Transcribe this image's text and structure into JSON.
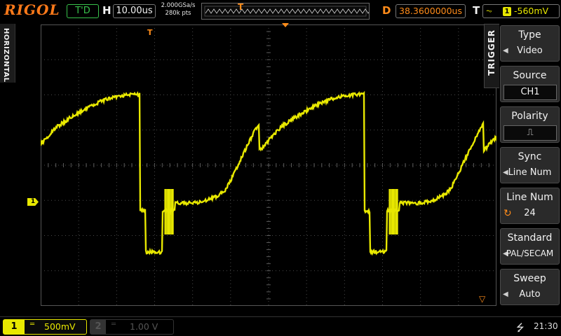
{
  "brand": "RIGOL",
  "topbar": {
    "run_state": "T'D",
    "h_label": "H",
    "timebase": "10.00us",
    "sample_rate": "2.000GSa/s",
    "memory_depth": "280k pts",
    "delay_label": "D",
    "delay": "38.3600000us",
    "trigger_label": "T",
    "trigger_type_icon": "video-trigger-icon",
    "trigger_channel": "1",
    "trigger_level": "-560mV",
    "trigger_marker": "T"
  },
  "left_tab": "HORIZONTAL",
  "screen": {
    "ch1_marker": "1"
  },
  "right_menu": {
    "tab": "TRIGGER",
    "items": [
      {
        "label": "Type",
        "value": "Video"
      },
      {
        "label": "Source",
        "value": "CH1"
      },
      {
        "label": "Polarity",
        "value": "⎍"
      },
      {
        "label": "Sync",
        "value": "Line Num"
      },
      {
        "label": "Line Num",
        "value": "24"
      },
      {
        "label": "Standard",
        "value": "PAL/SECAM"
      },
      {
        "label": "Sweep",
        "value": "Auto"
      }
    ]
  },
  "bottombar": {
    "ch1_num": "1",
    "ch1_coupling": "═",
    "ch1_scale": "500mV",
    "ch2_num": "2",
    "ch2_coupling": "═",
    "ch2_scale": "1.00 V",
    "clock": "21:30"
  },
  "colors": {
    "ch1": "#e8e800",
    "accent": "#ff8c1a",
    "status_green": "#38c24b"
  }
}
